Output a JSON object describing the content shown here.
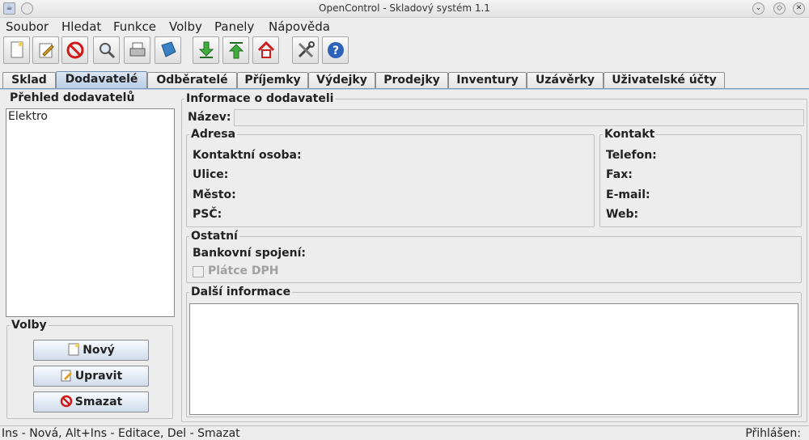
{
  "window": {
    "title": "OpenControl - Skladový systém 1.1"
  },
  "menu": [
    "Soubor",
    "Hledat",
    "Funkce",
    "Volby",
    "Panely",
    "Nápověda"
  ],
  "toolbar_icons": [
    "new-document-icon",
    "edit-icon",
    "stop-icon",
    "search-icon",
    "print-icon",
    "book-icon",
    "download-icon",
    "upload-icon",
    "home-icon",
    "tools-icon",
    "help-icon"
  ],
  "tabs": [
    "Sklad",
    "Dodavatelé",
    "Odběratelé",
    "Příjemky",
    "Výdejky",
    "Prodejky",
    "Inventury",
    "Uzávěrky",
    "Uživatelské účty"
  ],
  "active_tab": "Dodavatelé",
  "left": {
    "overview_title": "Přehled dodavatelů",
    "suppliers": [
      "Elektro"
    ],
    "options_title": "Volby",
    "buttons": {
      "new": "Nový",
      "edit": "Upravit",
      "delete": "Smazat"
    }
  },
  "info": {
    "title": "Informace o dodavateli",
    "name_label": "Název:",
    "address": {
      "title": "Adresa",
      "contact_person": "Kontaktní osoba:",
      "street": "Ulice:",
      "city": "Město:",
      "zip": "PSČ:"
    },
    "contact": {
      "title": "Kontakt",
      "phone": "Telefon:",
      "fax": "Fax:",
      "email": "E-mail:",
      "web": "Web:"
    },
    "other": {
      "title": "Ostatní",
      "bank": "Bankovní spojení:",
      "vat_payer": "Plátce DPH"
    },
    "more": {
      "title": "Další informace"
    }
  },
  "status": {
    "hint": "Ins - Nová, Alt+Ins - Editace, Del - Smazat",
    "logged_in": "Přihlášen:"
  }
}
